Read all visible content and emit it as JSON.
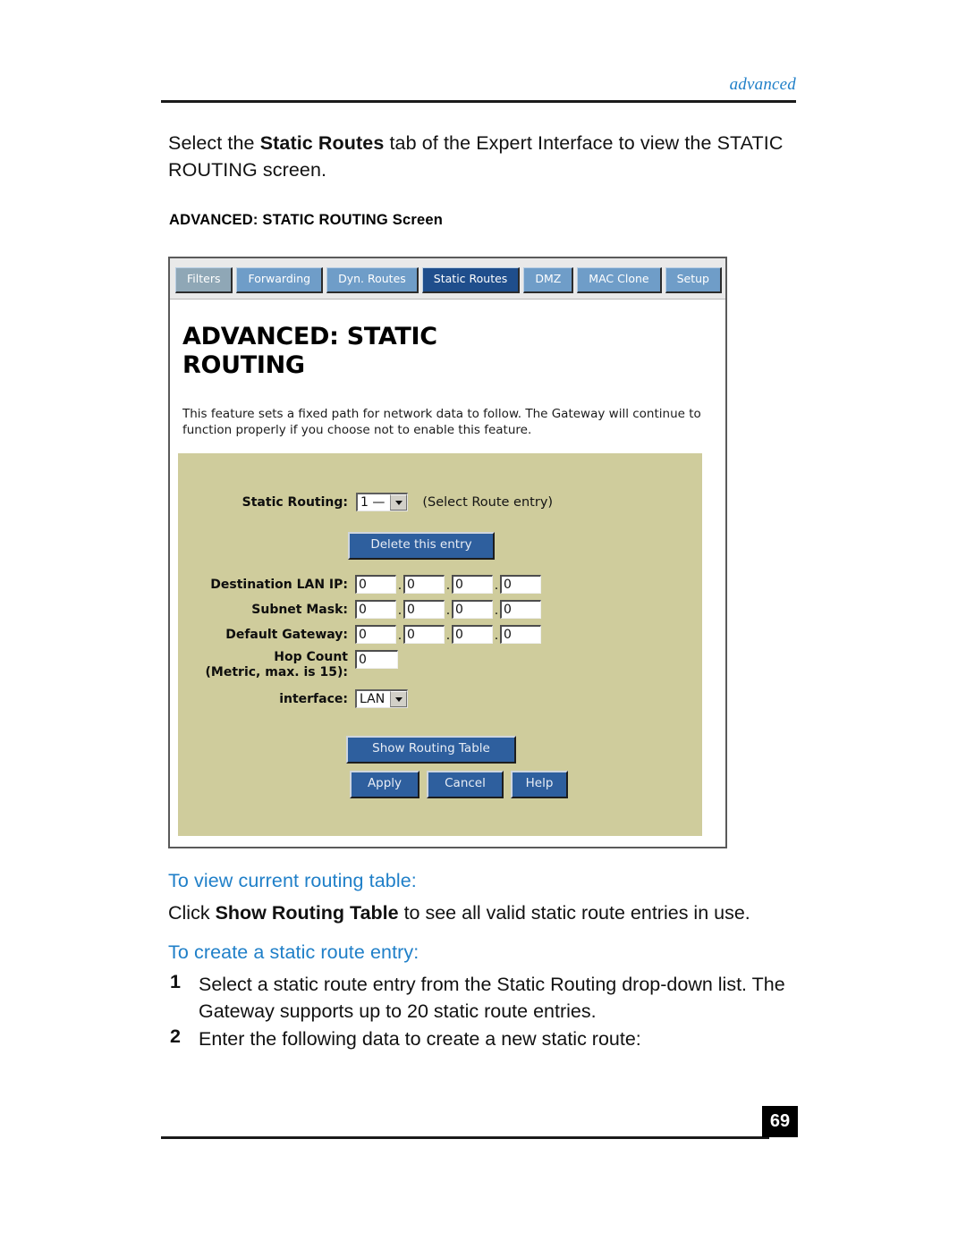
{
  "header": {
    "running_head": "advanced"
  },
  "intro": {
    "before": "Select the ",
    "bold": "Static Routes",
    "after": " tab of the Expert Interface to view the STATIC ROUTING screen."
  },
  "figure_caption": "ADVANCED: STATIC ROUTING Screen",
  "screenshot": {
    "tabs": [
      {
        "label": "Filters",
        "state": "gray"
      },
      {
        "label": "Forwarding",
        "state": "normal"
      },
      {
        "label": "Dyn. Routes",
        "state": "normal"
      },
      {
        "label": "Static Routes",
        "state": "active"
      },
      {
        "label": "DMZ",
        "state": "normal"
      },
      {
        "label": "MAC Clone",
        "state": "normal"
      },
      {
        "label": "Setup",
        "state": "normal"
      }
    ],
    "title": "ADVANCED: STATIC ROUTING",
    "description": "This feature sets a fixed path for network data to follow. The Gateway will continue to function properly if you choose not to enable this feature.",
    "form": {
      "static_routing_label": "Static Routing:",
      "static_routing_value": "1 —",
      "static_routing_hint": "(Select Route entry)",
      "delete_button": "Delete this entry",
      "destination_lan_ip_label": "Destination LAN IP:",
      "destination_lan_ip": [
        "0",
        "0",
        "0",
        "0"
      ],
      "subnet_mask_label": "Subnet Mask:",
      "subnet_mask": [
        "0",
        "0",
        "0",
        "0"
      ],
      "default_gateway_label": "Default Gateway:",
      "default_gateway": [
        "0",
        "0",
        "0",
        "0"
      ],
      "hop_count_label_line1": "Hop Count",
      "hop_count_label_line2": "(Metric, max. is 15):",
      "hop_count_value": "0",
      "interface_label": "interface:",
      "interface_value": "LAN",
      "show_routing_table_button": "Show Routing Table",
      "apply_button": "Apply",
      "cancel_button": "Cancel",
      "help_button": "Help"
    },
    "colors": {
      "panel": "#cfcc9c",
      "tab_active": "#1f4e8c",
      "tab_normal": "#6f9dc8",
      "tab_gray": "#8fa7b6",
      "button": "#2e5f9e"
    }
  },
  "sections": [
    {
      "heading": "To view current routing table:",
      "body_before": "Click ",
      "body_bold": "Show Routing Table",
      "body_after": " to see all valid static route entries in use."
    },
    {
      "heading": "To create a static route entry:"
    }
  ],
  "steps": [
    {
      "number": "1",
      "text": "Select a static route entry from the Static Routing drop-down list. The Gateway supports up to 20 static route entries."
    },
    {
      "number": "2",
      "text": "Enter the following data to create a new static route:"
    }
  ],
  "footer": {
    "page_number": "69"
  }
}
